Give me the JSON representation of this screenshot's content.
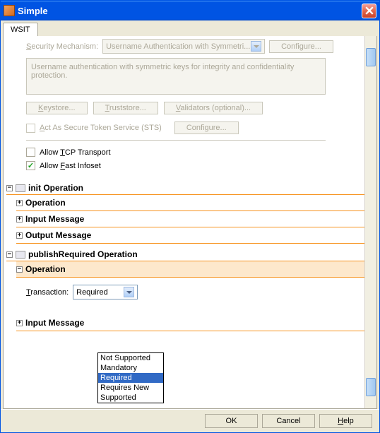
{
  "window": {
    "title": "Simple"
  },
  "tabs": [
    {
      "label": "WSIT"
    }
  ],
  "security": {
    "mech_label": "Security Mechanism:",
    "mech_value": "Username Authentication with Symmetri...",
    "configure": "Configure...",
    "desc": "Username authentication with symmetric keys for integrity and confidentiality protection.",
    "keystore": "Keystore...",
    "truststore": "Truststore...",
    "validators": "Validators (optional)...",
    "sts_label": "Act As Secure Token Service (STS)",
    "configure2": "Configure...",
    "tcp_label": "Allow TCP Transport",
    "fast_label": "Allow Fast Infoset"
  },
  "sections": {
    "init": "init Operation",
    "publish": "publishRequired Operation",
    "operation": "Operation",
    "input": "Input Message",
    "output": "Output Message"
  },
  "transaction": {
    "label": "Transaction:",
    "value": "Required",
    "options": [
      "Not Supported",
      "Mandatory",
      "Required",
      "Requires New",
      "Supported"
    ]
  },
  "footer": {
    "ok": "OK",
    "cancel": "Cancel",
    "help": "Help"
  },
  "underlines": {
    "sec_mech_s": "S",
    "sec_mech_rest": "ecurity Mechanism:",
    "key_k": "K",
    "key_rest": "eystore...",
    "trust_t": "T",
    "trust_rest": "ruststore...",
    "val_v": "V",
    "val_rest": "alidators (optional)...",
    "sts_a": "A",
    "sts_rest": "ct As Secure Token Service (STS)",
    "tcp_t": "T",
    "tcp_rest": "CP Transport",
    "fi_f": "F",
    "fi_rest": "ast Infoset",
    "tx_t": "T",
    "tx_rest": "ransaction:",
    "help_h": "H",
    "help_rest": "elp",
    "allow": "Allow "
  }
}
